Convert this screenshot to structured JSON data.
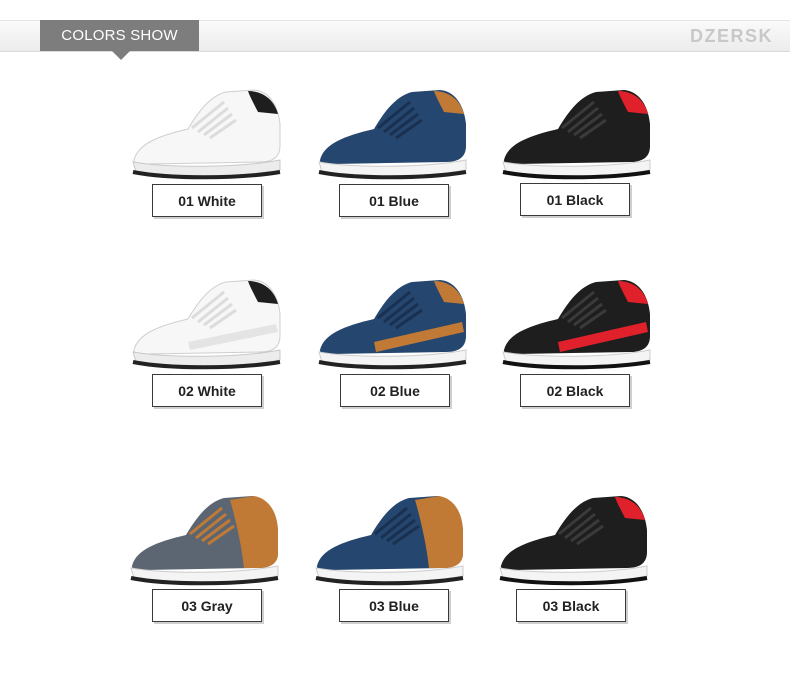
{
  "header": {
    "section_title": "COLORS SHOW",
    "brand": "DZERSK"
  },
  "colors": {
    "tab_bg": "#7d7d7d",
    "brand_text": "#c8c8c8",
    "white_upper": "#f7f7f7",
    "blue_upper": "#25466e",
    "black_upper": "#1e1e1e",
    "gray_upper": "#5c6672",
    "tan_accent": "#c07a35",
    "red_accent": "#e0202a"
  },
  "products": [
    {
      "label": "01 White",
      "icon": "white-sneaker-icon"
    },
    {
      "label": "01 Blue",
      "icon": "blue-sneaker-icon"
    },
    {
      "label": "01 Black",
      "icon": "black-sneaker-icon"
    },
    {
      "label": "02 White",
      "icon": "white-sneaker-icon"
    },
    {
      "label": "02 Blue",
      "icon": "blue-sneaker-icon"
    },
    {
      "label": "02 Black",
      "icon": "black-sneaker-icon"
    },
    {
      "label": "03 Gray",
      "icon": "gray-sneaker-icon"
    },
    {
      "label": "03 Blue",
      "icon": "blue-sneaker-icon"
    },
    {
      "label": "03 Black",
      "icon": "black-sneaker-icon"
    }
  ]
}
